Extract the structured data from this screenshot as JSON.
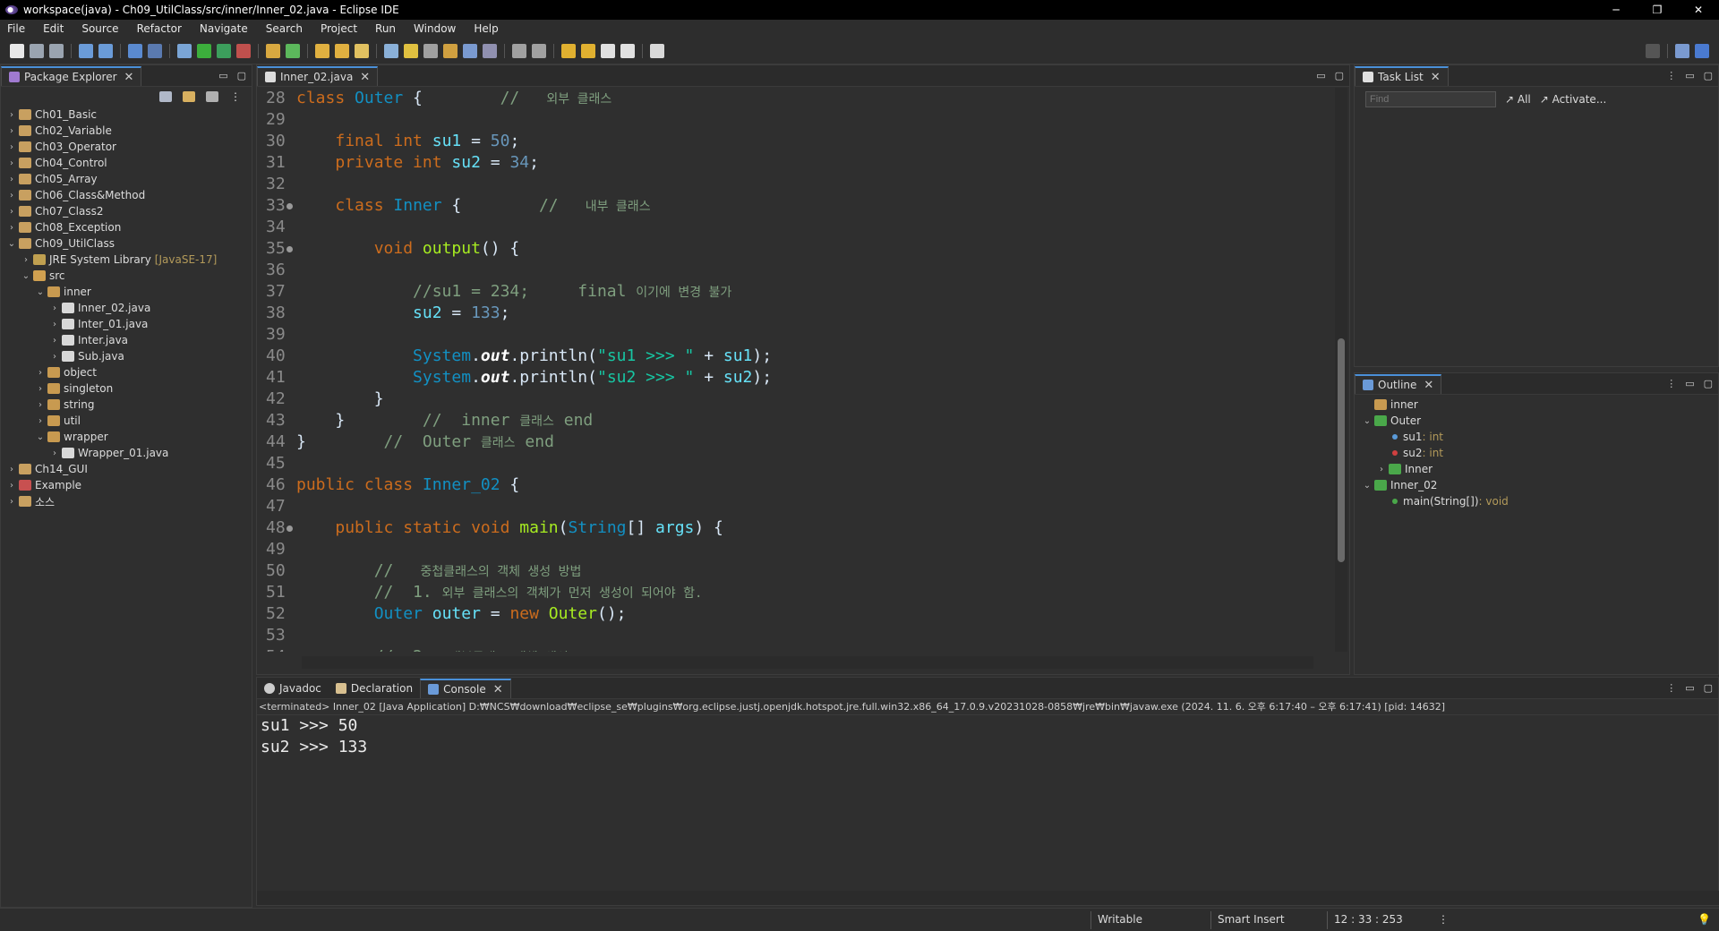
{
  "window": {
    "title": "workspace(java) - Ch09_UtilClass/src/inner/Inner_02.java - Eclipse IDE",
    "controls": [
      "─",
      "❐",
      "✕"
    ]
  },
  "menu": [
    "File",
    "Edit",
    "Source",
    "Refactor",
    "Navigate",
    "Search",
    "Project",
    "Run",
    "Window",
    "Help"
  ],
  "package_explorer": {
    "tab_label": "Package Explorer",
    "tree": [
      {
        "label": "Ch01_Basic",
        "depth": 0,
        "arrow": "›",
        "icon": "project-icon"
      },
      {
        "label": "Ch02_Variable",
        "depth": 0,
        "arrow": "›",
        "icon": "project-icon"
      },
      {
        "label": "Ch03_Operator",
        "depth": 0,
        "arrow": "›",
        "icon": "project-icon"
      },
      {
        "label": "Ch04_Control",
        "depth": 0,
        "arrow": "›",
        "icon": "project-icon"
      },
      {
        "label": "Ch05_Array",
        "depth": 0,
        "arrow": "›",
        "icon": "project-icon"
      },
      {
        "label": "Ch06_Class&Method",
        "depth": 0,
        "arrow": "›",
        "icon": "project-icon"
      },
      {
        "label": "Ch07_Class2",
        "depth": 0,
        "arrow": "›",
        "icon": "project-icon"
      },
      {
        "label": "Ch08_Exception",
        "depth": 0,
        "arrow": "›",
        "icon": "project-icon"
      },
      {
        "label": "Ch09_UtilClass",
        "depth": 0,
        "arrow": "⌄",
        "icon": "project-icon"
      },
      {
        "label": "JRE System Library",
        "decor": "[JavaSE-17]",
        "depth": 1,
        "arrow": "›",
        "icon": "library-icon"
      },
      {
        "label": "src",
        "depth": 1,
        "arrow": "⌄",
        "icon": "source-folder-icon"
      },
      {
        "label": "inner",
        "depth": 2,
        "arrow": "⌄",
        "icon": "package-icon"
      },
      {
        "label": "Inner_02.java",
        "depth": 3,
        "arrow": "›",
        "icon": "java-file-icon"
      },
      {
        "label": "Inter_01.java",
        "depth": 3,
        "arrow": "›",
        "icon": "java-file-icon"
      },
      {
        "label": "Inter.java",
        "depth": 3,
        "arrow": "›",
        "icon": "java-file-icon"
      },
      {
        "label": "Sub.java",
        "depth": 3,
        "arrow": "›",
        "icon": "java-file-icon"
      },
      {
        "label": "object",
        "depth": 2,
        "arrow": "›",
        "icon": "package-icon"
      },
      {
        "label": "singleton",
        "depth": 2,
        "arrow": "›",
        "icon": "package-icon"
      },
      {
        "label": "string",
        "depth": 2,
        "arrow": "›",
        "icon": "package-icon"
      },
      {
        "label": "util",
        "depth": 2,
        "arrow": "›",
        "icon": "package-icon"
      },
      {
        "label": "wrapper",
        "depth": 2,
        "arrow": "⌄",
        "icon": "package-icon"
      },
      {
        "label": "Wrapper_01.java",
        "depth": 3,
        "arrow": "›",
        "icon": "java-file-icon"
      },
      {
        "label": "Ch14_GUI",
        "depth": 0,
        "arrow": "›",
        "icon": "project-icon"
      },
      {
        "label": "Example",
        "depth": 0,
        "arrow": "›",
        "icon": "project-error-icon"
      },
      {
        "label": "소스",
        "depth": 0,
        "arrow": "›",
        "icon": "project-icon"
      }
    ]
  },
  "editor": {
    "tab_label": "Inner_02.java",
    "lines": [
      {
        "n": "28",
        "fold": false,
        "tokens": [
          [
            "kw",
            "class "
          ],
          [
            "ty",
            "Outer"
          ],
          [
            "plain",
            " {        "
          ],
          [
            "cm",
            "//  "
          ],
          [
            "cmk",
            " 외부 클래스"
          ]
        ]
      },
      {
        "n": "29",
        "fold": false,
        "tokens": []
      },
      {
        "n": "30",
        "fold": false,
        "tokens": [
          [
            "plain",
            "    "
          ],
          [
            "kw",
            "final int "
          ],
          [
            "fld",
            "su1"
          ],
          [
            "plain",
            " = "
          ],
          [
            "num",
            "50"
          ],
          [
            "plain",
            ";"
          ]
        ]
      },
      {
        "n": "31",
        "fold": false,
        "tokens": [
          [
            "plain",
            "    "
          ],
          [
            "kw",
            "private int "
          ],
          [
            "fld",
            "su2"
          ],
          [
            "plain",
            " = "
          ],
          [
            "num",
            "34"
          ],
          [
            "plain",
            ";"
          ]
        ]
      },
      {
        "n": "32",
        "fold": false,
        "tokens": []
      },
      {
        "n": "33",
        "fold": true,
        "tokens": [
          [
            "plain",
            "    "
          ],
          [
            "kw",
            "class "
          ],
          [
            "ty",
            "Inner"
          ],
          [
            "plain",
            " {        "
          ],
          [
            "cm",
            "//  "
          ],
          [
            "cmk",
            " 내부 클래스"
          ]
        ]
      },
      {
        "n": "34",
        "fold": false,
        "tokens": []
      },
      {
        "n": "35",
        "fold": true,
        "tokens": [
          [
            "plain",
            "        "
          ],
          [
            "kw",
            "void "
          ],
          [
            "mth",
            "output"
          ],
          [
            "plain",
            "() {"
          ]
        ]
      },
      {
        "n": "36",
        "fold": false,
        "tokens": []
      },
      {
        "n": "37",
        "fold": false,
        "tokens": [
          [
            "plain",
            "            "
          ],
          [
            "cm",
            "//su1 = 234;     final "
          ],
          [
            "cmk",
            "이기에 변경 불가"
          ]
        ]
      },
      {
        "n": "38",
        "fold": false,
        "tokens": [
          [
            "plain",
            "            "
          ],
          [
            "fld",
            "su2"
          ],
          [
            "plain",
            " = "
          ],
          [
            "num",
            "133"
          ],
          [
            "plain",
            ";"
          ]
        ]
      },
      {
        "n": "39",
        "fold": false,
        "tokens": []
      },
      {
        "n": "40",
        "fold": false,
        "tokens": [
          [
            "plain",
            "            "
          ],
          [
            "ty",
            "System"
          ],
          [
            "plain",
            "."
          ],
          [
            "bold-i",
            "out"
          ],
          [
            "plain",
            ".println("
          ],
          [
            "str",
            "\"su1 >>> \""
          ],
          [
            "plain",
            " + "
          ],
          [
            "fld",
            "su1"
          ],
          [
            "plain",
            ");"
          ]
        ]
      },
      {
        "n": "41",
        "fold": false,
        "tokens": [
          [
            "plain",
            "            "
          ],
          [
            "ty",
            "System"
          ],
          [
            "plain",
            "."
          ],
          [
            "bold-i",
            "out"
          ],
          [
            "plain",
            ".println("
          ],
          [
            "str",
            "\"su2 >>> \""
          ],
          [
            "plain",
            " + "
          ],
          [
            "fld",
            "su2"
          ],
          [
            "plain",
            ");"
          ]
        ]
      },
      {
        "n": "42",
        "fold": false,
        "tokens": [
          [
            "plain",
            "        }"
          ]
        ]
      },
      {
        "n": "43",
        "fold": false,
        "tokens": [
          [
            "plain",
            "    }        "
          ],
          [
            "cm",
            "//  inner "
          ],
          [
            "cmk",
            "클래스"
          ],
          [
            "cm",
            " end"
          ]
        ]
      },
      {
        "n": "44",
        "fold": false,
        "tokens": [
          [
            "plain",
            "}        "
          ],
          [
            "cm",
            "//  Outer "
          ],
          [
            "cmk",
            "클래스"
          ],
          [
            "cm",
            " end"
          ]
        ]
      },
      {
        "n": "45",
        "fold": false,
        "tokens": []
      },
      {
        "n": "46",
        "fold": false,
        "tokens": [
          [
            "kw",
            "public class "
          ],
          [
            "ty",
            "Inner_02"
          ],
          [
            "plain",
            " {"
          ]
        ]
      },
      {
        "n": "47",
        "fold": false,
        "tokens": []
      },
      {
        "n": "48",
        "fold": true,
        "tokens": [
          [
            "plain",
            "    "
          ],
          [
            "kw",
            "public static void "
          ],
          [
            "mth",
            "main"
          ],
          [
            "plain",
            "("
          ],
          [
            "ty",
            "String"
          ],
          [
            "plain",
            "[] "
          ],
          [
            "fld",
            "args"
          ],
          [
            "plain",
            ") {"
          ]
        ]
      },
      {
        "n": "49",
        "fold": false,
        "tokens": []
      },
      {
        "n": "50",
        "fold": false,
        "tokens": [
          [
            "plain",
            "        "
          ],
          [
            "cm",
            "//  "
          ],
          [
            "cmk",
            " 중첩클래스의 객체 생성 방법"
          ]
        ]
      },
      {
        "n": "51",
        "fold": false,
        "tokens": [
          [
            "plain",
            "        "
          ],
          [
            "cm",
            "//  1. "
          ],
          [
            "cmk",
            "외부 클래스의 객체가 먼저 생성이 되어야 함."
          ]
        ]
      },
      {
        "n": "52",
        "fold": false,
        "tokens": [
          [
            "plain",
            "        "
          ],
          [
            "ty",
            "Outer"
          ],
          [
            "plain",
            " "
          ],
          [
            "fld",
            "outer"
          ],
          [
            "plain",
            " = "
          ],
          [
            "kw",
            "new "
          ],
          [
            "mth",
            "Outer"
          ],
          [
            "plain",
            "();"
          ]
        ]
      },
      {
        "n": "53",
        "fold": false,
        "tokens": []
      },
      {
        "n": "54",
        "fold": false,
        "tokens": [
          [
            "plain",
            "        "
          ],
          [
            "cm",
            "//  2. "
          ],
          [
            "cmk",
            " 내부클래스 객체 생성"
          ]
        ]
      }
    ]
  },
  "task_list": {
    "tab_label": "Task List",
    "find_placeholder": "Find",
    "all_label": "All",
    "activate_label": "Activate..."
  },
  "outline": {
    "tab_label": "Outline",
    "tree": [
      {
        "label": "inner",
        "type": "",
        "depth": 0,
        "arrow": "",
        "icon": "package-icon"
      },
      {
        "label": "Outer",
        "type": "",
        "depth": 0,
        "arrow": "⌄",
        "icon": "class-icon"
      },
      {
        "label": "su1",
        "type": " : int",
        "depth": 1,
        "arrow": "",
        "icon": "field-icon"
      },
      {
        "label": "su2",
        "type": " : int",
        "depth": 1,
        "arrow": "",
        "icon": "private-field-icon"
      },
      {
        "label": "Inner",
        "type": "",
        "depth": 1,
        "arrow": "›",
        "icon": "class-icon"
      },
      {
        "label": "Inner_02",
        "type": "",
        "depth": 0,
        "arrow": "⌄",
        "icon": "class-icon"
      },
      {
        "label": "main(String[])",
        "type": " : void",
        "depth": 1,
        "arrow": "",
        "icon": "method-icon"
      }
    ]
  },
  "console": {
    "tabs": [
      "Javadoc",
      "Declaration",
      "Console"
    ],
    "header": "<terminated> Inner_02 [Java Application] D:₩NCS₩download₩eclipse_se₩plugins₩org.eclipse.justj.openjdk.hotspot.jre.full.win32.x86_64_17.0.9.v20231028-0858₩jre₩bin₩javaw.exe  (2024. 11. 6. 오후 6:17:40 – 오후 6:17:41) [pid: 14632]",
    "output": [
      "su1 >>> 50",
      "su2 >>> 133"
    ]
  },
  "status": {
    "writable": "Writable",
    "insert_mode": "Smart Insert",
    "position": "12 : 33 : 253"
  },
  "colors": {
    "accent": "#4a90d9",
    "background": "#2f2f2f"
  }
}
